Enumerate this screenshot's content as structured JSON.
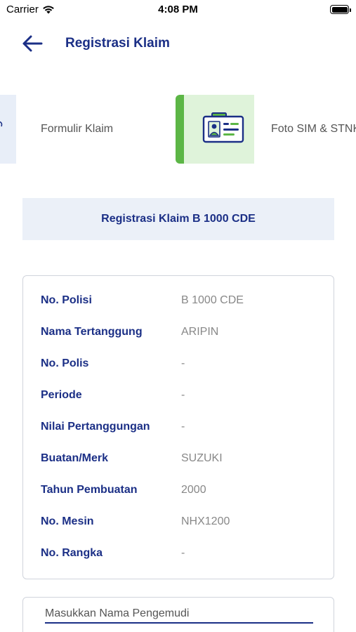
{
  "status_bar": {
    "carrier": "Carrier",
    "time": "4:08 PM"
  },
  "nav": {
    "title": "Registrasi Klaim",
    "back_icon": "arrow-left-icon"
  },
  "steps": [
    {
      "label": "Formulir Klaim",
      "state": "inactive"
    },
    {
      "label": "Foto SIM & STNK",
      "state": "active",
      "icon": "id-card-icon"
    }
  ],
  "section": {
    "title": "Registrasi Klaim B 1000 CDE"
  },
  "info": [
    {
      "label": "No. Polisi",
      "value": "B 1000 CDE"
    },
    {
      "label": "Nama Tertanggung",
      "value": "ARIPIN"
    },
    {
      "label": "No. Polis",
      "value": "-"
    },
    {
      "label": "Periode",
      "value": "-"
    },
    {
      "label": "Nilai Pertanggungan",
      "value": "-"
    },
    {
      "label": "Buatan/Merk",
      "value": "SUZUKI"
    },
    {
      "label": "Tahun Pembuatan",
      "value": "2000"
    },
    {
      "label": "No. Mesin",
      "value": "NHX1200"
    },
    {
      "label": "No. Rangka",
      "value": "-"
    }
  ],
  "driver": {
    "placeholder": "Masukkan Nama Pengemudi",
    "value": ""
  },
  "colors": {
    "primary": "#1b2f86",
    "active_step_bg": "#dff3da",
    "active_step_accent": "#5cb646",
    "header_bg": "#ebf0f8"
  }
}
